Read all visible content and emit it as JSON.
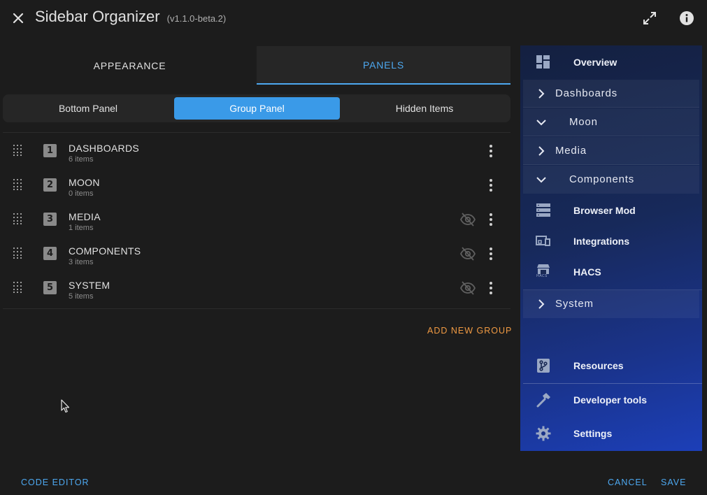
{
  "dialog": {
    "title": "Sidebar Organizer",
    "version": "(v1.1.0-beta.2)"
  },
  "tabs": [
    {
      "label": "APPEARANCE",
      "active": false
    },
    {
      "label": "PANELS",
      "active": true
    }
  ],
  "segments": [
    {
      "label": "Bottom Panel",
      "selected": false
    },
    {
      "label": "Group Panel",
      "selected": true
    },
    {
      "label": "Hidden Items",
      "selected": false
    }
  ],
  "groups": [
    {
      "index": "1",
      "name": "DASHBOARDS",
      "count": "6 items",
      "hidden": false
    },
    {
      "index": "2",
      "name": "MOON",
      "count": "0 items",
      "hidden": false
    },
    {
      "index": "3",
      "name": "MEDIA",
      "count": "1 items",
      "hidden": true
    },
    {
      "index": "4",
      "name": "COMPONENTS",
      "count": "3 items",
      "hidden": true
    },
    {
      "index": "5",
      "name": "SYSTEM",
      "count": "5 items",
      "hidden": true
    }
  ],
  "actions": {
    "add_group": "ADD NEW GROUP",
    "code_editor": "CODE EDITOR",
    "cancel": "CANCEL",
    "save": "SAVE"
  },
  "preview": {
    "overview": "Overview",
    "groups": [
      {
        "label": "Dashboards",
        "expanded": false
      },
      {
        "label": "Moon",
        "expanded": true
      },
      {
        "label": "Media",
        "expanded": false
      },
      {
        "label": "Components",
        "expanded": true
      },
      {
        "label": "System",
        "expanded": false
      }
    ],
    "component_items": [
      "Browser Mod",
      "Integrations",
      "HACS"
    ],
    "hacs_icon_text": "HACS",
    "bottom_items": [
      "Resources",
      "Developer tools",
      "Settings"
    ]
  },
  "colors": {
    "accent": "#4da8f0",
    "selected_segment": "#3a9ae8",
    "add_group": "#f09a43",
    "background": "#1c1c1c"
  }
}
